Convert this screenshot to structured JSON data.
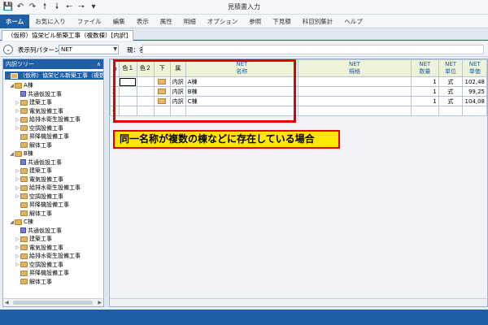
{
  "window": {
    "title": "見積書入力"
  },
  "ribbon": {
    "tabs": [
      "ホーム",
      "お気に入り",
      "ファイル",
      "編集",
      "表示",
      "属性",
      "明細",
      "オプション",
      "参照",
      "下見積",
      "科目別集計",
      "ヘルプ"
    ],
    "active_index": 0
  },
  "document": {
    "tab_title": "（仮称）協栄ビル新築工事（複数棟）[内訳]"
  },
  "toolbar": {
    "pattern_label": "表示列パターン",
    "pattern_value": "NET",
    "parent_label": "親：名称",
    "parent_value": ""
  },
  "tree": {
    "header": "内訳ツリー",
    "root": "（仮称）協栄ビル新築工事（複数棟）",
    "groups": [
      {
        "name": "A棟",
        "items": [
          "共通仮設工事",
          "建築工事",
          "電気設備工事",
          "給排水衛生設備工事",
          "空調設備工事",
          "昇降機設備工事",
          "解体工事"
        ]
      },
      {
        "name": "B棟",
        "items": [
          "共通仮設工事",
          "建築工事",
          "電気設備工事",
          "給排水衛生設備工事",
          "空調設備工事",
          "昇降機設備工事",
          "解体工事"
        ]
      },
      {
        "name": "C棟",
        "items": [
          "共通仮設工事",
          "建築工事",
          "電気設備工事",
          "給排水衛生設備工事",
          "空調設備工事",
          "昇降機設備工事",
          "解体工事"
        ]
      }
    ]
  },
  "grid": {
    "headers": {
      "color1": "色１",
      "color2": "色２",
      "down": "下",
      "attr": "属",
      "name_top": "NET",
      "name_bottom": "名称",
      "spec_top": "NET",
      "spec_bottom": "規格",
      "qty_top": "NET",
      "qty_bottom": "数量",
      "unit_top": "NET",
      "unit_bottom": "単位",
      "price_top": "NET",
      "price_bottom": "単価"
    },
    "rows": [
      {
        "num": "1",
        "attr": "内訳",
        "name": "A棟",
        "spec": "",
        "qty": "1",
        "unit": "式",
        "price": "102,48"
      },
      {
        "num": "2",
        "attr": "内訳",
        "name": "B棟",
        "spec": "",
        "qty": "1",
        "unit": "式",
        "price": "99,25"
      },
      {
        "num": "3",
        "attr": "内訳",
        "name": "C棟",
        "spec": "",
        "qty": "1",
        "unit": "式",
        "price": "104,08"
      }
    ],
    "new_row_marker": "*"
  },
  "callout": {
    "text": "同一名称が複数の棟などに存在している場合"
  },
  "colors": {
    "accent": "#1f5fa8",
    "highlight_red": "#e00000",
    "callout_yellow": "#ffe800"
  }
}
